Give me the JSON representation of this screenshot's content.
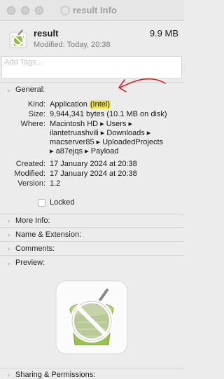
{
  "window": {
    "title": "result Info"
  },
  "header": {
    "name": "result",
    "size": "9.9 MB",
    "modified": "Modified: Today, 20:38"
  },
  "tags": {
    "placeholder": "Add Tags..."
  },
  "general": {
    "heading": "General:",
    "kind_label": "Kind:",
    "kind_value_prefix": "Application ",
    "kind_value_highlight": "(Intel)",
    "size_label": "Size:",
    "size_value": "9,944,341 bytes (10.1 MB on disk)",
    "where_label": "Where:",
    "where_lines": [
      "Macintosh HD ▸ Users ▸",
      "ilantetruashvili ▸ Downloads ▸",
      "macserver85 ▸ UploadedProjects",
      "▸ a87ejqs ▸ Payload"
    ],
    "created_label": "Created:",
    "created_value": "17 January 2024 at 20:38",
    "modified_label": "Modified:",
    "modified_value": "17 January 2024 at 20:38",
    "version_label": "Version:",
    "version_value": "1.2",
    "locked_label": "Locked"
  },
  "sections": {
    "more_info": "More Info:",
    "name_ext": "Name & Extension:",
    "comments": "Comments:",
    "preview": "Preview:",
    "sharing": "Sharing & Permissions:"
  },
  "icons": {
    "chevron_down": "chevron-down-icon",
    "chevron_right": "chevron-right-icon",
    "app": "unsupported-app-icon"
  },
  "colors": {
    "highlight": "#f2e64c",
    "annotation_arrow": "#e02020"
  }
}
